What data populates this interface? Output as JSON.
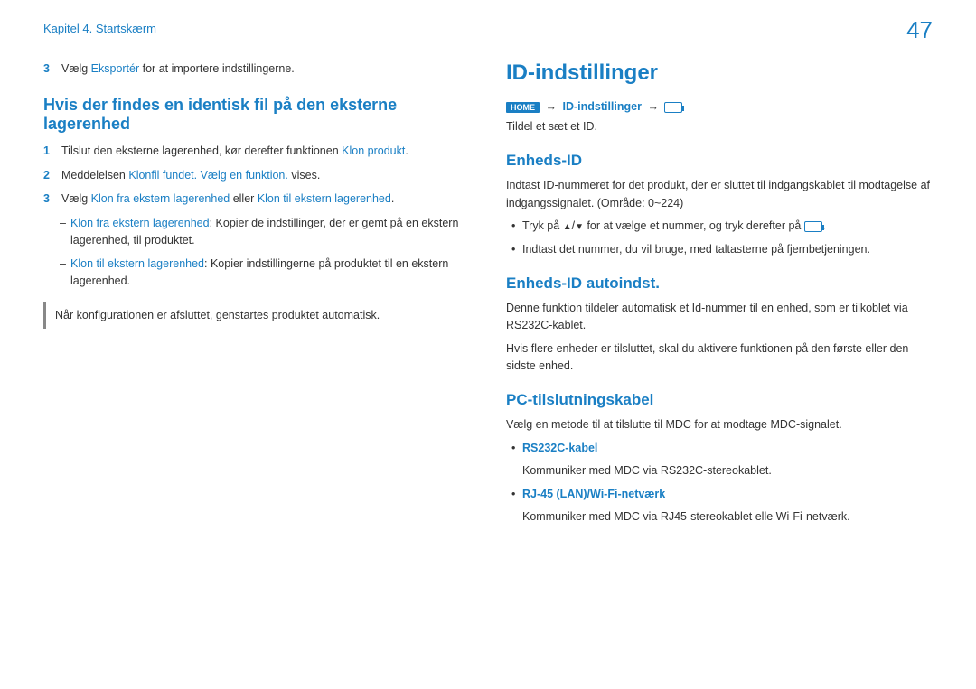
{
  "page_number": "47",
  "chapter": "Kapitel 4. Startskærm",
  "left": {
    "step3_num": "3",
    "step3_a": "Vælg ",
    "step3_hl": "Eksportér",
    "step3_b": " for at importere indstillingerne.",
    "h2": "Hvis der findes en identisk fil på den eksterne lagerenhed",
    "s1_num": "1",
    "s1_a": "Tilslut den eksterne lagerenhed, kør derefter funktionen ",
    "s1_hl": "Klon produkt",
    "s1_b": ".",
    "s2_num": "2",
    "s2_a": "Meddelelsen ",
    "s2_hl": "Klonfil fundet. Vælg en funktion.",
    "s2_b": " vises.",
    "s3_num": "3",
    "s3_a": "Vælg ",
    "s3_hl1": "Klon fra ekstern lagerenhed",
    "s3_mid": " eller ",
    "s3_hl2": "Klon til ekstern lagerenhed",
    "s3_b": ".",
    "sub1_hl": "Klon fra ekstern lagerenhed",
    "sub1_txt": ": Kopier de indstillinger, der er gemt på en ekstern lagerenhed, til produktet.",
    "sub2_hl": "Klon til ekstern lagerenhed",
    "sub2_txt": ": Kopier indstillingerne på produktet til en ekstern lagerenhed.",
    "note": "Når konfigurationen er afsluttet, genstartes produktet automatisk."
  },
  "right": {
    "h1": "ID-indstillinger",
    "nav_home": "HOME",
    "nav_hl": "ID-indstillinger",
    "tildel": "Tildel et sæt et ID.",
    "h3_1": "Enheds-ID",
    "p1": "Indtast ID-nummeret for det produkt, der er sluttet til indgangskablet til modtagelse af indgangssignalet. (Område: 0~224)",
    "b1_a": "Tryk på ",
    "b1_b": " for at vælge et nummer, og tryk derefter på ",
    "b1_c": ".",
    "b2": "Indtast det nummer, du vil bruge, med taltasterne på fjernbetjeningen.",
    "h3_2": "Enheds-ID autoindst.",
    "p2": "Denne funktion tildeler automatisk et Id-nummer til en enhed, som er tilkoblet via RS232C-kablet.",
    "p3": "Hvis flere enheder er tilsluttet, skal du aktivere funktionen på den første eller den sidste enhed.",
    "h3_3": "PC-tilslutningskabel",
    "p4": "Vælg en metode til at tilslutte til MDC for at modtage MDC-signalet.",
    "cb1_hl": "RS232C-kabel",
    "cb1_txt": "Kommuniker med MDC via RS232C-stereokablet.",
    "cb2_hl": "RJ-45 (LAN)/Wi-Fi-netværk",
    "cb2_txt": "Kommuniker med MDC via RJ45-stereokablet elle Wi-Fi-netværk."
  }
}
